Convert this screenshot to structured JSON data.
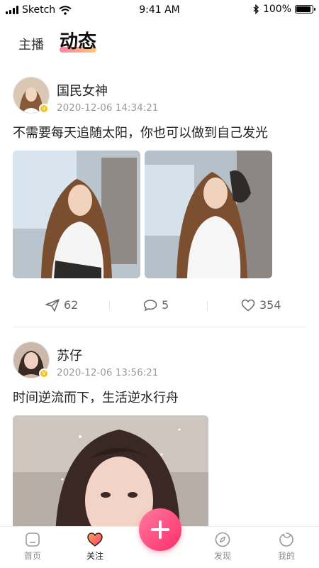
{
  "status_bar": {
    "carrier": "Sketch",
    "time": "9:41 AM",
    "battery": "100%",
    "battery_level": 1.0
  },
  "header": {
    "tabs": [
      {
        "label": "主播",
        "active": false
      },
      {
        "label": "动态",
        "active": true
      }
    ]
  },
  "posts": [
    {
      "username": "国民女神",
      "time": "2020-12-06 14:34:21",
      "text": "不需要每天追随太阳，你也可以做到自己发光",
      "stats": {
        "shares": "62",
        "comments": "5",
        "likes": "354"
      }
    },
    {
      "username": "苏仔",
      "time": "2020-12-06 13:56:21",
      "text": "时间逆流而下，生活逆水行舟"
    }
  ],
  "bottom_nav": {
    "items": [
      {
        "label": "首页",
        "icon": "home-icon"
      },
      {
        "label": "关注",
        "icon": "heart-icon",
        "active": true
      },
      {
        "label": "",
        "icon": "plus-icon"
      },
      {
        "label": "发现",
        "icon": "compass-icon"
      },
      {
        "label": "我的",
        "icon": "profile-icon"
      }
    ]
  },
  "colors": {
    "accent": "#ff3c78",
    "badge": "#f5c21a"
  }
}
